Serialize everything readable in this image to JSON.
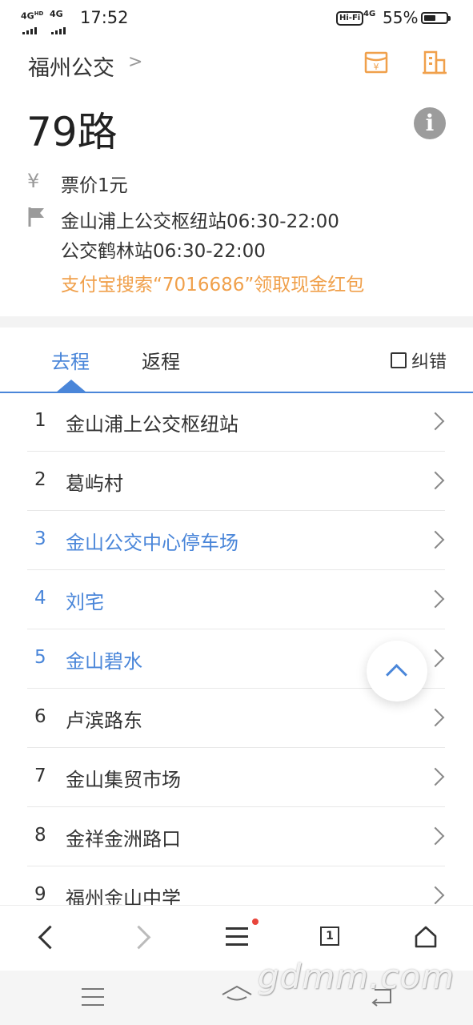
{
  "status_bar": {
    "signal1": "4G",
    "signal1_sup": "HD",
    "signal2": "4G",
    "time": "17:52",
    "hifi": "Hi-Fi",
    "net": "4G",
    "battery_percent": "55%",
    "battery_level": 0.55
  },
  "header": {
    "city": "福州公交",
    "city_arrow": ">",
    "route_name": "79路",
    "fare": "票价1元",
    "terminal_1": "金山浦上公交枢纽站06:30-22:00",
    "terminal_2": "公交鹤林站06:30-22:00",
    "promo": "支付宝搜索“7016686”领取现金红包",
    "info_glyph": "i",
    "icons": [
      "red-envelope-icon",
      "building-icon",
      "info-icon",
      "yuan-icon",
      "flag-icon"
    ]
  },
  "tabs": {
    "outbound": "去程",
    "return": "返程",
    "report": "纠错",
    "active": "outbound"
  },
  "stops": [
    {
      "num": "1",
      "name": "金山浦上公交枢纽站",
      "highlight": false
    },
    {
      "num": "2",
      "name": "葛屿村",
      "highlight": false
    },
    {
      "num": "3",
      "name": "金山公交中心停车场",
      "highlight": true
    },
    {
      "num": "4",
      "name": "刘宅",
      "highlight": true
    },
    {
      "num": "5",
      "name": "金山碧水",
      "highlight": true
    },
    {
      "num": "6",
      "name": "卢滨路东",
      "highlight": false
    },
    {
      "num": "7",
      "name": "金山集贸市场",
      "highlight": false
    },
    {
      "num": "8",
      "name": "金祥金洲路口",
      "highlight": false
    },
    {
      "num": "9",
      "name": "福州金山中学",
      "highlight": false
    }
  ],
  "browser_bar": {
    "tab_count": "1"
  },
  "watermark": "gdmm.com",
  "colors": {
    "accent_blue": "#4a86d9",
    "accent_orange": "#f0a04b",
    "text_dark": "#333333",
    "icon_gray": "#9c9c9c"
  }
}
